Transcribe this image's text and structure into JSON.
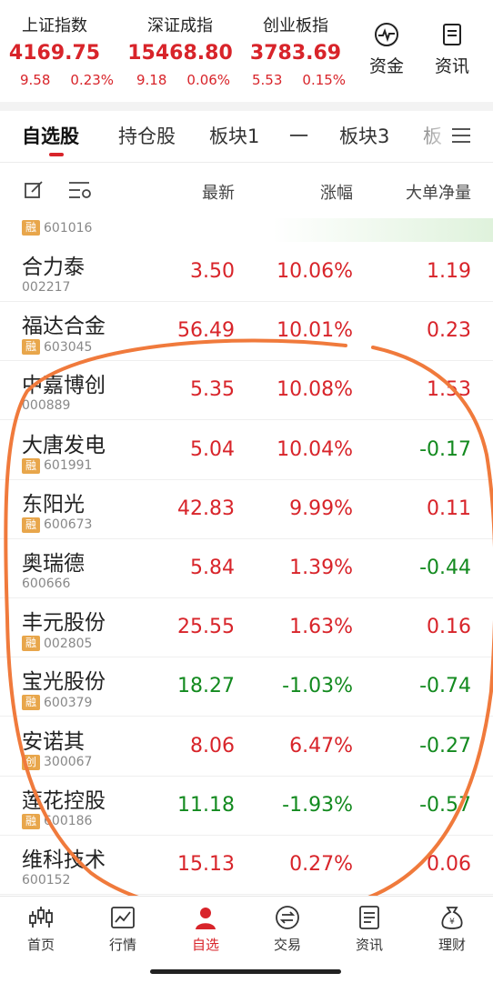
{
  "indices": [
    {
      "name": "上证指数",
      "value": "4169.75",
      "change": "9.58",
      "pct": "0.23%"
    },
    {
      "name": "深证成指",
      "value": "15468.80",
      "change": "9.18",
      "pct": "0.06%"
    },
    {
      "name": "创业板指",
      "value": "3783.69",
      "change": "5.53",
      "pct": "0.15%"
    }
  ],
  "header_buttons": {
    "funds": "资金",
    "news": "资讯"
  },
  "tabs": [
    "自选股",
    "持仓股",
    "板块1",
    "一",
    "板块3",
    "板"
  ],
  "columns": {
    "latest": "最新",
    "change": "涨幅",
    "net": "大单净量"
  },
  "partial_row": {
    "badge": "融",
    "code": "601016"
  },
  "stocks": [
    {
      "name": "合力泰",
      "code": "002217",
      "badge": "",
      "price": "3.50",
      "pct": "10.06%",
      "net": "1.19",
      "pc": "red",
      "nc": "red"
    },
    {
      "name": "福达合金",
      "code": "603045",
      "badge": "融",
      "price": "56.49",
      "pct": "10.01%",
      "net": "0.23",
      "pc": "red",
      "nc": "red"
    },
    {
      "name": "中嘉博创",
      "code": "000889",
      "badge": "",
      "price": "5.35",
      "pct": "10.08%",
      "net": "1.53",
      "pc": "red",
      "nc": "red"
    },
    {
      "name": "大唐发电",
      "code": "601991",
      "badge": "融",
      "price": "5.04",
      "pct": "10.04%",
      "net": "-0.17",
      "pc": "red",
      "nc": "green"
    },
    {
      "name": "东阳光",
      "code": "600673",
      "badge": "融",
      "price": "42.83",
      "pct": "9.99%",
      "net": "0.11",
      "pc": "red",
      "nc": "red"
    },
    {
      "name": "奥瑞德",
      "code": "600666",
      "badge": "",
      "price": "5.84",
      "pct": "1.39%",
      "net": "-0.44",
      "pc": "red",
      "nc": "green"
    },
    {
      "name": "丰元股份",
      "code": "002805",
      "badge": "融",
      "price": "25.55",
      "pct": "1.63%",
      "net": "0.16",
      "pc": "red",
      "nc": "red"
    },
    {
      "name": "宝光股份",
      "code": "600379",
      "badge": "融",
      "price": "18.27",
      "pct": "-1.03%",
      "net": "-0.74",
      "pc": "green",
      "nc": "green"
    },
    {
      "name": "安诺其",
      "code": "300067",
      "badge": "创",
      "price": "8.06",
      "pct": "6.47%",
      "net": "-0.27",
      "pc": "red",
      "nc": "green"
    },
    {
      "name": "莲花控股",
      "code": "600186",
      "badge": "融",
      "price": "11.18",
      "pct": "-1.93%",
      "net": "-0.57",
      "pc": "green",
      "nc": "green"
    },
    {
      "name": "维科技术",
      "code": "600152",
      "badge": "",
      "price": "15.13",
      "pct": "0.27%",
      "net": "0.06",
      "pc": "red",
      "nc": "red"
    }
  ],
  "nav": [
    "首页",
    "行情",
    "自选",
    "交易",
    "资讯",
    "理财"
  ],
  "colors": {
    "up": "#d8242a",
    "down": "#138a1f",
    "annotation": "#f07a3c",
    "badge": "#e8a64b"
  }
}
